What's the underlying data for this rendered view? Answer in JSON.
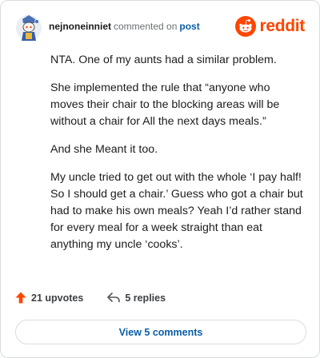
{
  "comment": {
    "username": "nejnoneinniet",
    "action": "commented on",
    "target": "post",
    "brand": "reddit",
    "paragraphs": [
      "NTA. One of my aunts had a similar problem.",
      "She implemented the rule that “anyone who moves their chair to the blocking areas will be without a chair for All the next days meals.”",
      "And she Meant it too.",
      "My uncle tried to get out with the whole ‘I pay half! So I should get a chair.’ Guess who got a chair but had to make his own meals? Yeah I’d rather stand for every meal for a week straight than eat anything my uncle ‘cooks’."
    ]
  },
  "footer": {
    "upvotes": "21 upvotes",
    "replies": "5 replies",
    "view_button": "View 5 comments"
  },
  "colors": {
    "brand": "#ff4500",
    "link": "#0a5ea8",
    "muted": "#6b6f72",
    "border": "#d9dcdf"
  },
  "icons": {
    "avatar": "snoo-avatar-icon",
    "logo": "reddit-snoo-icon",
    "upvote": "upvote-arrow-icon",
    "reply": "reply-arrow-icon"
  }
}
